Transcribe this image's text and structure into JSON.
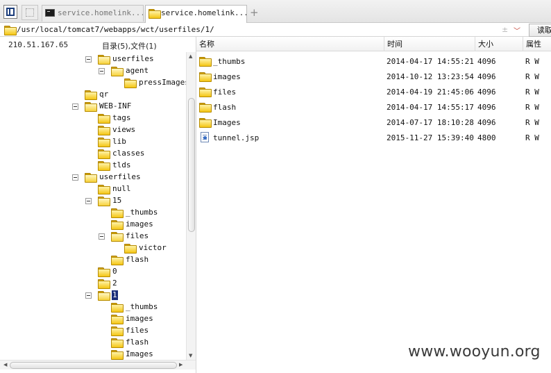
{
  "tabs": [
    {
      "label": "service.homelink....",
      "icon": "terminal-icon",
      "active": false
    },
    {
      "label": "service.homelink....",
      "icon": "folder-icon",
      "active": true
    }
  ],
  "new_tab_label": "+",
  "path": {
    "value": "/usr/local/tomcat7/webapps/wct/userfiles/1/",
    "separator": "±",
    "dropdown": "﹀",
    "read_button": "读取"
  },
  "left_header": {
    "ip": "210.51.167.65",
    "counts": "目录(5),文件(1)"
  },
  "tree": [
    {
      "label": "userfiles",
      "level": 1,
      "expanded": true
    },
    {
      "label": "agent",
      "level": 2,
      "expanded": true
    },
    {
      "label": "pressImages",
      "level": 3,
      "expanded": false
    },
    {
      "label": "qr",
      "level": 0,
      "expanded": false
    },
    {
      "label": "WEB-INF",
      "level": 0,
      "expanded": true
    },
    {
      "label": "tags",
      "level": 1,
      "expanded": false
    },
    {
      "label": "views",
      "level": 1,
      "expanded": false
    },
    {
      "label": "lib",
      "level": 1,
      "expanded": false
    },
    {
      "label": "classes",
      "level": 1,
      "expanded": false
    },
    {
      "label": "tlds",
      "level": 1,
      "expanded": false
    },
    {
      "label": "userfiles",
      "level": 0,
      "expanded": true
    },
    {
      "label": "null",
      "level": 1,
      "expanded": false
    },
    {
      "label": "15",
      "level": 1,
      "expanded": true
    },
    {
      "label": "_thumbs",
      "level": 2,
      "expanded": false
    },
    {
      "label": "images",
      "level": 2,
      "expanded": false
    },
    {
      "label": "files",
      "level": 2,
      "expanded": true
    },
    {
      "label": "victor",
      "level": 3,
      "expanded": false
    },
    {
      "label": "flash",
      "level": 2,
      "expanded": false
    },
    {
      "label": "0",
      "level": 1,
      "expanded": false
    },
    {
      "label": "2",
      "level": 1,
      "expanded": false
    },
    {
      "label": "1",
      "level": 1,
      "expanded": true,
      "selected": true
    },
    {
      "label": "_thumbs",
      "level": 2,
      "expanded": false
    },
    {
      "label": "images",
      "level": 2,
      "expanded": false
    },
    {
      "label": "files",
      "level": 2,
      "expanded": false
    },
    {
      "label": "flash",
      "level": 2,
      "expanded": false
    },
    {
      "label": "Images",
      "level": 2,
      "expanded": false
    }
  ],
  "columns": {
    "name": "名称",
    "time": "时间",
    "size": "大小",
    "attr": "属性"
  },
  "files": [
    {
      "name": "_thumbs",
      "time": "2014-04-17 14:55:21",
      "size": "4096",
      "attr": "R W",
      "type": "folder"
    },
    {
      "name": "images",
      "time": "2014-10-12 13:23:54",
      "size": "4096",
      "attr": "R W",
      "type": "folder"
    },
    {
      "name": "files",
      "time": "2014-04-19 21:45:06",
      "size": "4096",
      "attr": "R W",
      "type": "folder"
    },
    {
      "name": "flash",
      "time": "2014-04-17 14:55:17",
      "size": "4096",
      "attr": "R W",
      "type": "folder"
    },
    {
      "name": "Images",
      "time": "2014-07-17 18:10:28",
      "size": "4096",
      "attr": "R W",
      "type": "folder"
    },
    {
      "name": "tunnel.jsp",
      "time": "2015-11-27 15:39:40",
      "size": "4800",
      "attr": "R W",
      "type": "file"
    }
  ],
  "watermark": "www.wooyun.org"
}
